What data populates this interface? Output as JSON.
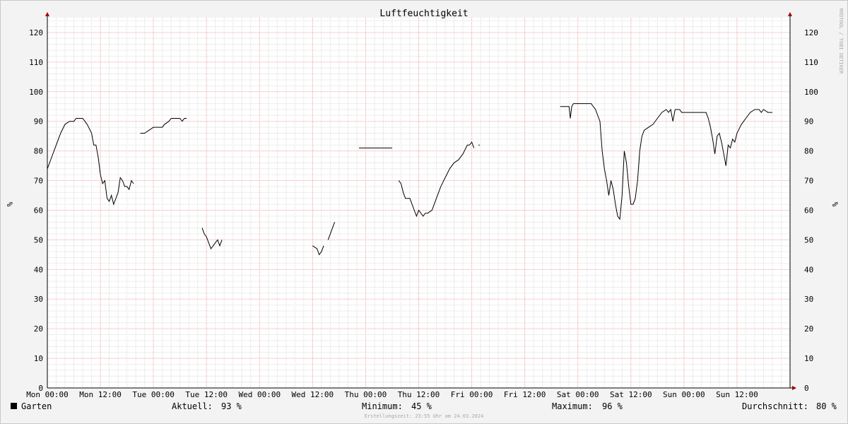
{
  "chart_data": {
    "type": "line",
    "title": "Luftfeuchtigkeit",
    "ylabel": "%",
    "ylim": [
      0,
      125
    ],
    "yticks": [
      0,
      10,
      20,
      30,
      40,
      50,
      60,
      70,
      80,
      90,
      100,
      110,
      120
    ],
    "xlim_hours": [
      0,
      168
    ],
    "xticks": [
      "Mon 00:00",
      "Mon 12:00",
      "Tue 00:00",
      "Tue 12:00",
      "Wed 00:00",
      "Wed 12:00",
      "Thu 00:00",
      "Thu 12:00",
      "Fri 00:00",
      "Fri 12:00",
      "Sat 00:00",
      "Sat 12:00",
      "Sun 00:00",
      "Sun 12:00"
    ],
    "grid": true,
    "series": [
      {
        "name": "Garten",
        "color": "#000000",
        "segments": [
          [
            [
              0,
              74
            ],
            [
              1,
              78
            ],
            [
              2,
              82
            ],
            [
              3,
              86
            ],
            [
              4,
              89
            ],
            [
              5,
              90
            ],
            [
              6,
              90
            ],
            [
              6.5,
              91
            ],
            [
              8,
              91
            ],
            [
              8.5,
              90
            ],
            [
              9,
              89
            ],
            [
              10,
              86
            ],
            [
              10.5,
              82
            ],
            [
              11,
              82
            ],
            [
              11.5,
              78
            ],
            [
              12,
              72
            ],
            [
              12.5,
              69
            ],
            [
              13,
              70
            ],
            [
              13.5,
              64
            ],
            [
              14,
              63
            ],
            [
              14.5,
              65
            ],
            [
              15,
              62
            ],
            [
              15.5,
              64
            ],
            [
              16,
              66
            ],
            [
              16.5,
              71
            ],
            [
              17,
              70
            ],
            [
              17.5,
              68
            ],
            [
              18,
              68
            ],
            [
              18.5,
              67
            ],
            [
              19,
              70
            ],
            [
              19.5,
              69
            ]
          ],
          [
            [
              21,
              86
            ],
            [
              22,
              86
            ],
            [
              23,
              87
            ],
            [
              24,
              88
            ],
            [
              25,
              88
            ],
            [
              26,
              88
            ],
            [
              26.5,
              89
            ],
            [
              27.5,
              90
            ],
            [
              28,
              91
            ],
            [
              30,
              91
            ],
            [
              30.5,
              90
            ],
            [
              31,
              91
            ],
            [
              31.5,
              91
            ]
          ],
          [
            [
              35,
              54
            ],
            [
              35.5,
              52
            ],
            [
              36,
              51
            ],
            [
              36.5,
              49
            ],
            [
              37,
              47
            ],
            [
              37.5,
              48
            ],
            [
              38,
              49
            ],
            [
              38.5,
              50
            ],
            [
              39,
              48
            ],
            [
              39.5,
              50
            ]
          ],
          [
            [
              60,
              48
            ],
            [
              61,
              47
            ],
            [
              61.5,
              45
            ],
            [
              62,
              46
            ],
            [
              62.5,
              48
            ]
          ],
          [
            [
              63.5,
              50
            ],
            [
              64.5,
              54
            ],
            [
              65,
              56
            ]
          ],
          [
            [
              70.5,
              81
            ],
            [
              78,
              81
            ]
          ],
          [
            [
              79.5,
              70
            ],
            [
              80,
              69
            ],
            [
              80.5,
              66
            ],
            [
              81,
              64
            ],
            [
              82,
              64
            ],
            [
              82.5,
              62
            ],
            [
              83,
              60
            ],
            [
              83.5,
              58
            ],
            [
              84,
              60
            ],
            [
              84.5,
              59
            ],
            [
              85,
              58
            ],
            [
              85.5,
              59
            ],
            [
              86,
              59
            ],
            [
              87,
              60
            ],
            [
              88,
              64
            ],
            [
              89,
              68
            ],
            [
              90,
              71
            ],
            [
              91,
              74
            ],
            [
              92,
              76
            ],
            [
              93,
              77
            ],
            [
              94,
              79
            ],
            [
              95,
              82
            ],
            [
              95.5,
              82
            ],
            [
              96,
              83
            ],
            [
              96.5,
              81
            ]
          ],
          [
            [
              97.5,
              82
            ],
            [
              97.8,
              82
            ]
          ],
          [
            [
              116,
              95
            ],
            [
              118,
              95
            ],
            [
              118.3,
              91
            ],
            [
              118.6,
              95
            ],
            [
              119,
              96
            ],
            [
              123,
              96
            ],
            [
              124,
              94
            ],
            [
              125,
              90
            ],
            [
              125.5,
              80
            ],
            [
              126,
              74
            ],
            [
              126.5,
              70
            ],
            [
              127,
              65
            ],
            [
              127.5,
              70
            ],
            [
              128,
              67
            ],
            [
              128.5,
              62
            ],
            [
              129,
              58
            ],
            [
              129.5,
              57
            ],
            [
              130,
              65
            ],
            [
              130.5,
              80
            ],
            [
              131,
              76
            ],
            [
              131.5,
              68
            ],
            [
              132,
              62
            ],
            [
              132.5,
              62
            ],
            [
              133,
              64
            ],
            [
              133.5,
              70
            ],
            [
              134,
              80
            ],
            [
              134.5,
              85
            ],
            [
              135,
              87
            ],
            [
              136,
              88
            ],
            [
              137,
              89
            ],
            [
              138,
              91
            ],
            [
              139,
              93
            ],
            [
              140,
              94
            ],
            [
              140.5,
              93
            ],
            [
              141,
              94
            ],
            [
              141.5,
              90
            ],
            [
              142,
              94
            ],
            [
              143,
              94
            ],
            [
              143.5,
              93
            ],
            [
              149,
              93
            ],
            [
              149.5,
              91
            ],
            [
              150,
              88
            ],
            [
              150.5,
              84
            ],
            [
              151,
              79
            ],
            [
              151.5,
              85
            ],
            [
              152,
              86
            ],
            [
              152.5,
              83
            ],
            [
              153,
              79
            ],
            [
              153.5,
              75
            ],
            [
              154,
              82
            ],
            [
              154.5,
              81
            ],
            [
              155,
              84
            ],
            [
              155.5,
              83
            ],
            [
              156,
              86
            ],
            [
              157,
              89
            ],
            [
              158,
              91
            ],
            [
              159,
              93
            ],
            [
              160,
              94
            ],
            [
              161,
              94
            ],
            [
              161.5,
              93
            ],
            [
              162,
              94
            ],
            [
              163,
              93
            ],
            [
              164,
              93
            ]
          ]
        ]
      }
    ]
  },
  "legend": {
    "series_name": "Garten",
    "aktuell_label": "Aktuell:",
    "aktuell_value": "93 %",
    "minimum_label": "Minimum:",
    "minimum_value": "45 %",
    "maximum_label": "Maximum:",
    "maximum_value": "96 %",
    "avg_label": "Durchschnitt:",
    "avg_value": "80 %"
  },
  "footer": "Erstellungszeit: 23:55 Uhr am 24.03.2024",
  "watermark": "RRDTOOL / TOBI OETIKER",
  "colors": {
    "minor_grid": "#dcdcdc",
    "major_grid": "#f0a0a0",
    "axis_arrow": "#a00000",
    "background": "#f3f3f3",
    "plot": "#ffffff"
  }
}
